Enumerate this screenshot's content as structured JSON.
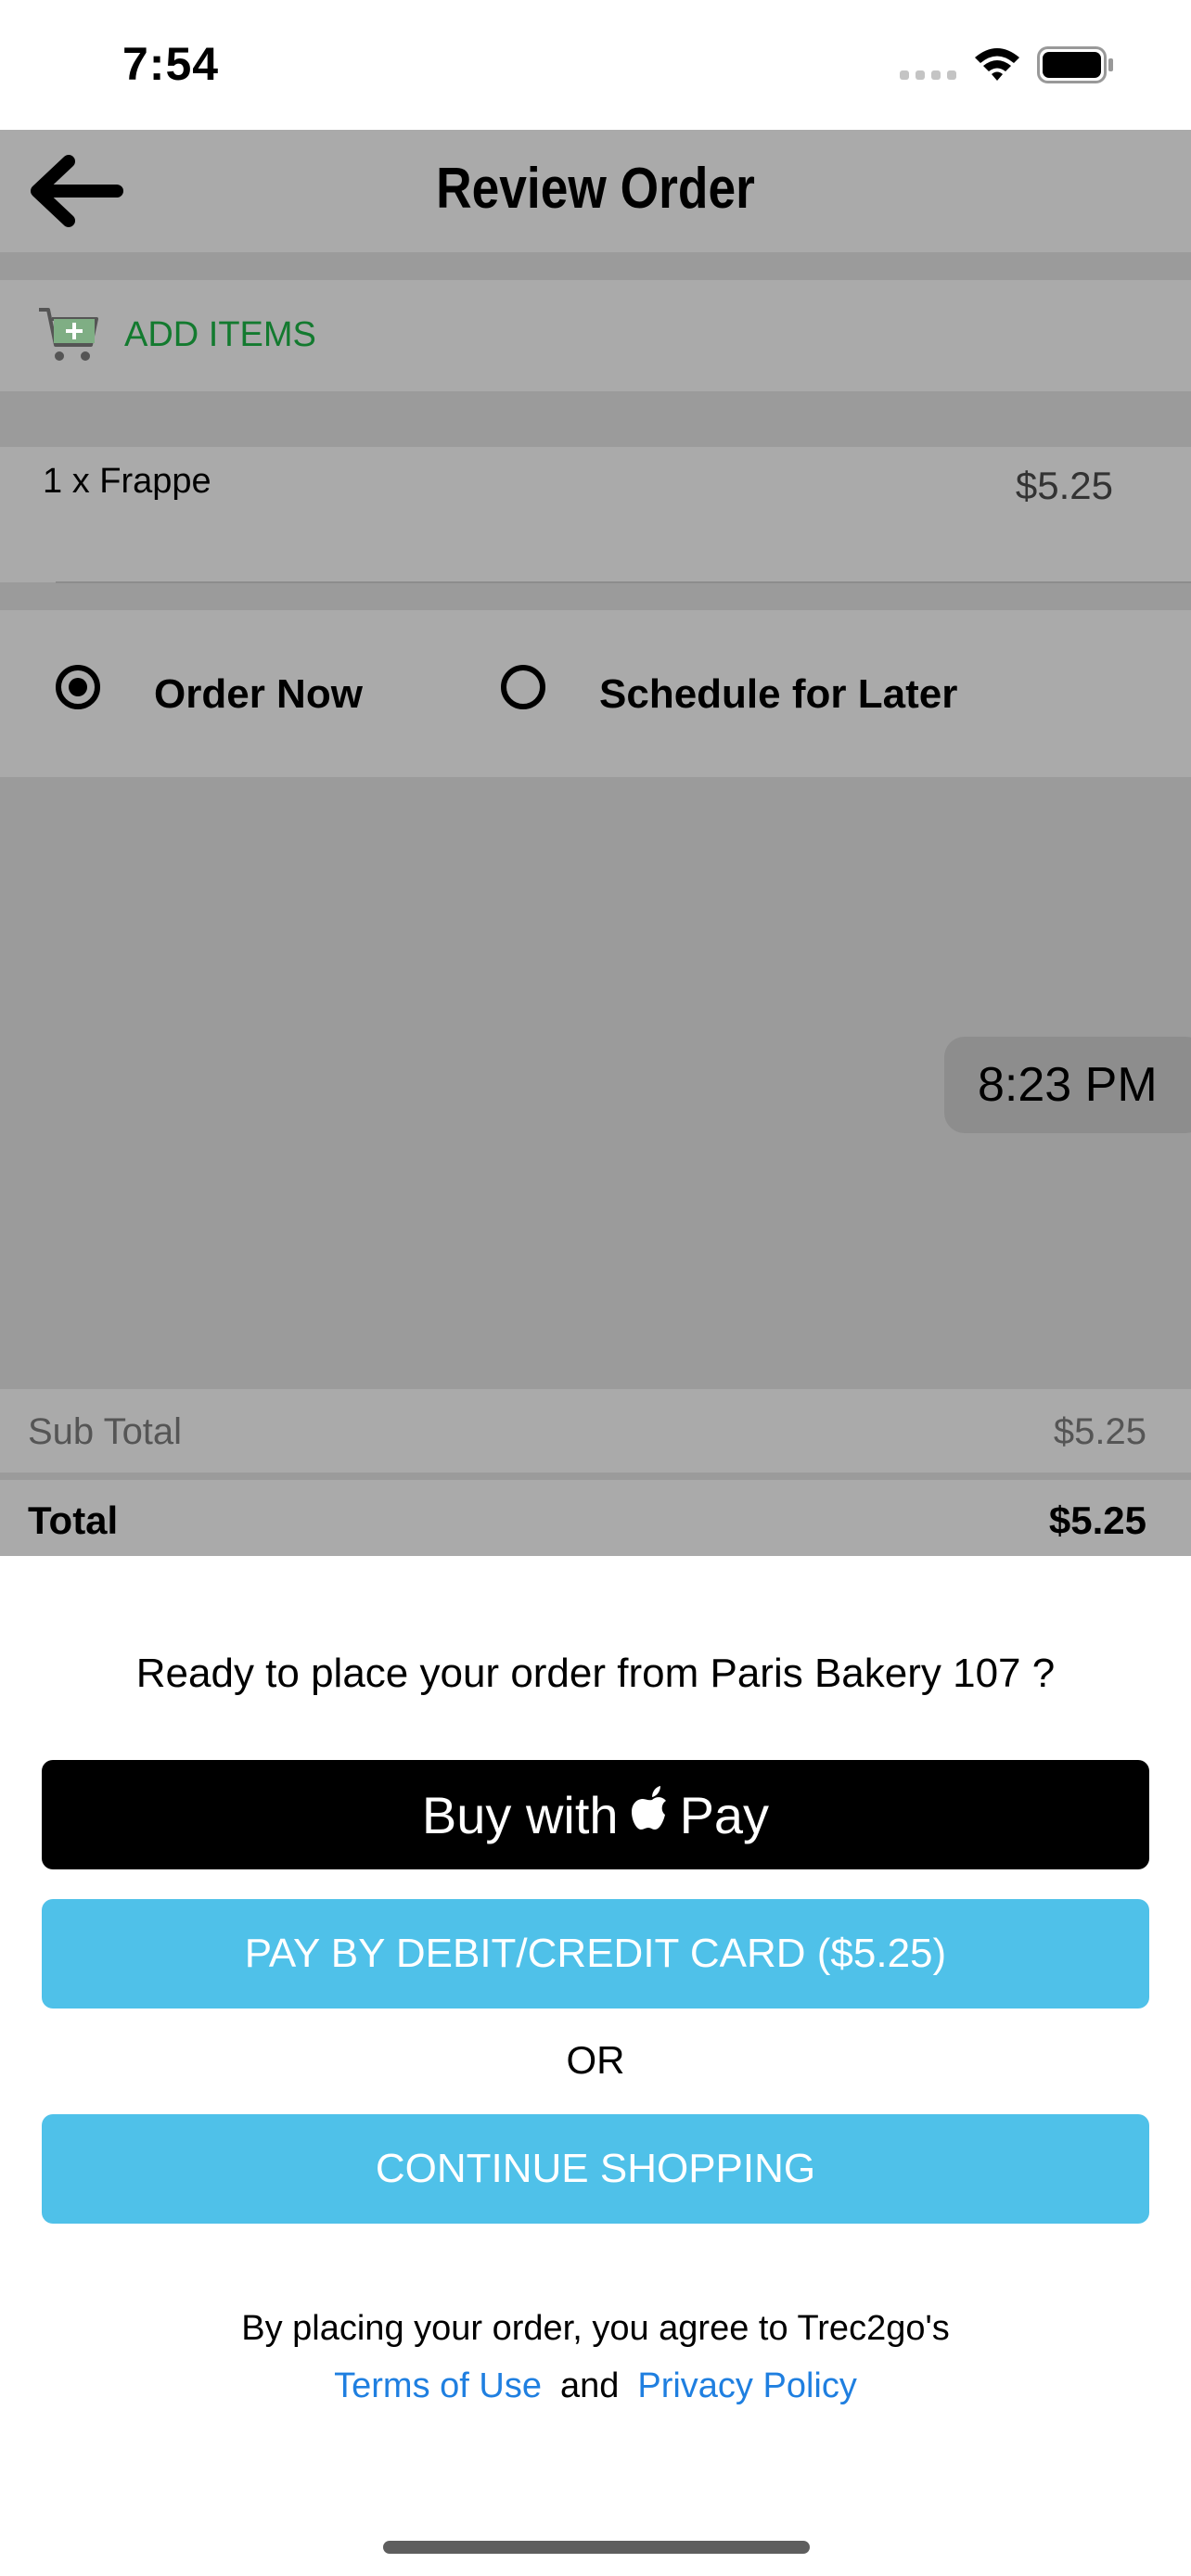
{
  "status_bar": {
    "time": "7:54"
  },
  "header": {
    "title": "Review Order"
  },
  "add_items": {
    "label": "ADD ITEMS"
  },
  "order": {
    "items": [
      {
        "name": "1 x Frappe",
        "price": "$5.25"
      }
    ]
  },
  "timing": {
    "options": [
      {
        "label": "Order Now",
        "selected": true
      },
      {
        "label": "Schedule for Later",
        "selected": false
      }
    ],
    "picker_time": "8:23 PM"
  },
  "totals": {
    "subtotal_label": "Sub Total",
    "subtotal_value": "$5.25",
    "total_label": "Total",
    "total_value": "$5.25"
  },
  "sheet": {
    "question": "Ready to place your order from Paris Bakery 107 ?",
    "apple_pay": {
      "prefix": "Buy with",
      "suffix": "Pay"
    },
    "card_button": "PAY BY DEBIT/CREDIT CARD ($5.25)",
    "or_label": "OR",
    "continue_button": "CONTINUE SHOPPING",
    "terms_text": "By placing your order, you agree to Trec2go's",
    "terms_link": "Terms of Use",
    "and_text": "and",
    "privacy_link": "Privacy Policy"
  },
  "colors": {
    "accent_blue": "#4fc1e9",
    "add_items_green": "#137a2f",
    "link_blue": "#1f7fe0",
    "overlay_gray": "#9b9b9b"
  },
  "icons": [
    "back-arrow-icon",
    "cart-plus-icon",
    "apple-icon",
    "wifi-icon",
    "battery-icon",
    "signal-icon"
  ]
}
